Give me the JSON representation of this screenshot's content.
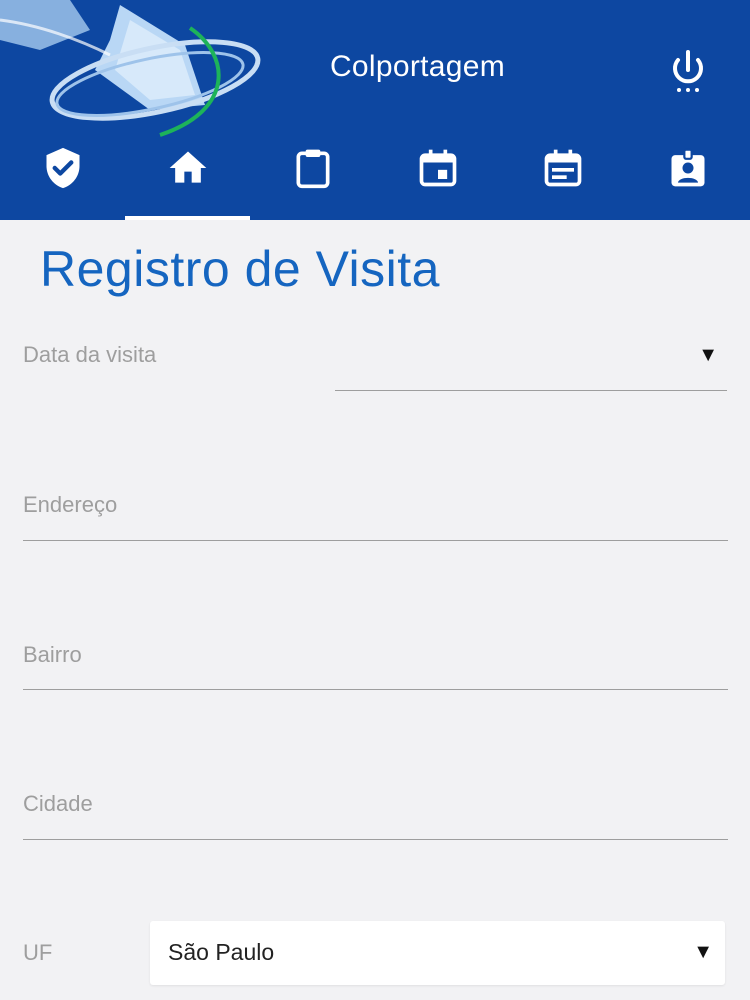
{
  "header": {
    "app_title": "Colportagem",
    "logo_icon": "globe-book-logo",
    "power_icon": "power-icon",
    "brand_color": "#0d47a1"
  },
  "tabs": [
    {
      "icon": "verified-shield-icon",
      "active": false
    },
    {
      "icon": "home-icon",
      "active": true
    },
    {
      "icon": "clipboard-icon",
      "active": false
    },
    {
      "icon": "calendar-event-icon",
      "active": false
    },
    {
      "icon": "calendar-notes-icon",
      "active": false
    },
    {
      "icon": "contact-badge-icon",
      "active": false
    }
  ],
  "page": {
    "title": "Registro de Visita",
    "title_color": "#1565c0"
  },
  "form": {
    "date_label": "Data da visita",
    "address_label": "Endereço",
    "neighborhood_label": "Bairro",
    "city_label": "Cidade",
    "state_label": "UF",
    "state_value": "São Paulo",
    "caret": "▼"
  }
}
